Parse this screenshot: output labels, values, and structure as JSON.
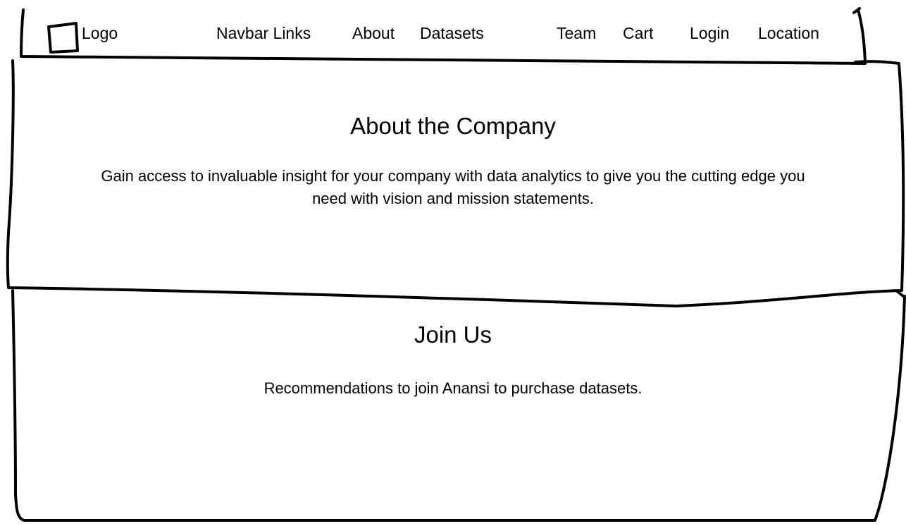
{
  "navbar": {
    "logo_label": "Logo",
    "links_placeholder": "Navbar Links",
    "links": [
      "About",
      "Datasets",
      "Team",
      "Cart",
      "Login",
      "Location"
    ]
  },
  "about_section": {
    "title": "About the Company",
    "line1": "Gain access to invaluable insight for your company with data analytics to give you the cutting edge you",
    "line2": "need with vision and mission statements."
  },
  "join_section": {
    "title": "Join Us",
    "text": "Recommendations to join Anansi to purchase datasets."
  },
  "colors": {
    "ink": "#000000",
    "background": "#ffffff"
  }
}
